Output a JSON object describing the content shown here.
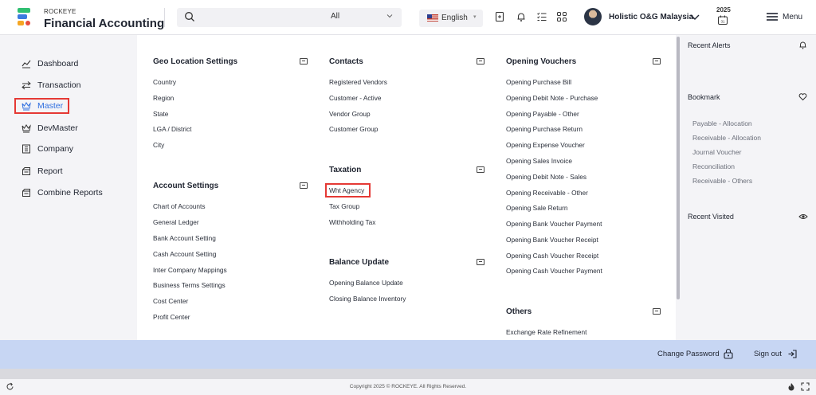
{
  "app": {
    "brand_top": "ROCKEYE",
    "brand_main": "Financial Accounting"
  },
  "header": {
    "search_scope": "All",
    "language": "English",
    "user_name": "Holistic O&G Malaysia",
    "year": "2025",
    "menu_label": "Menu"
  },
  "left_nav": [
    {
      "label": "Dashboard",
      "icon": "chart-line-icon"
    },
    {
      "label": "Transaction",
      "icon": "swap-icon"
    },
    {
      "label": "Master",
      "icon": "crown-icon",
      "active": true
    },
    {
      "label": "DevMaster",
      "icon": "crown-icon"
    },
    {
      "label": "Company",
      "icon": "building-icon"
    },
    {
      "label": "Report",
      "icon": "report-icon"
    },
    {
      "label": "Combine Reports",
      "icon": "report-icon"
    }
  ],
  "mega": {
    "geo": {
      "title": "Geo Location Settings",
      "items": [
        "Country",
        "Region",
        "State",
        "LGA / District",
        "City"
      ]
    },
    "account": {
      "title": "Account Settings",
      "items": [
        "Chart of Accounts",
        "General Ledger",
        "Bank Account Setting",
        "Cash Account Setting",
        "Inter Company Mappings",
        "Business Terms Settings",
        "Cost Center",
        "Profit Center"
      ]
    },
    "contacts": {
      "title": "Contacts",
      "items": [
        "Registered Vendors",
        "Customer - Active",
        "Vendor Group",
        "Customer Group"
      ]
    },
    "taxation": {
      "title": "Taxation",
      "items": [
        "Wht Agency",
        "Tax Group",
        "Withholding Tax"
      ]
    },
    "balance": {
      "title": "Balance Update",
      "items": [
        "Opening Balance Update",
        "Closing Balance Inventory"
      ]
    },
    "opening": {
      "title": "Opening Vouchers",
      "items": [
        "Opening Purchase Bill",
        "Opening Debit Note - Purchase",
        "Opening Payable - Other",
        "Opening Purchase Return",
        "Opening Expense Voucher",
        "Opening Sales Invoice",
        "Opening Debit Note - Sales",
        "Opening Receivable - Other",
        "Opening Sale Return",
        "Opening Bank Voucher Payment",
        "Opening Bank Voucher Receipt",
        "Opening Cash Voucher Receipt",
        "Opening Cash Voucher Payment"
      ]
    },
    "others": {
      "title": "Others",
      "items": [
        "Exchange Rate Refinement"
      ]
    }
  },
  "right_panel": {
    "alerts_title": "Recent Alerts",
    "bookmark_title": "Bookmark",
    "bookmarks": [
      "Payable - Allocation",
      "Receivable - Allocation",
      "Journal Voucher",
      "Reconciliation",
      "Receivable - Others"
    ],
    "visited_title": "Recent Visited"
  },
  "footer": {
    "change_password": "Change Password",
    "sign_out": "Sign out",
    "copyright": "Copyright 2025 © ROCKEYE. All Rights Reserved."
  },
  "colors": {
    "accent": "#2f6fe0",
    "highlight_border": "#e53935",
    "action_bar": "#c7d6f3"
  }
}
